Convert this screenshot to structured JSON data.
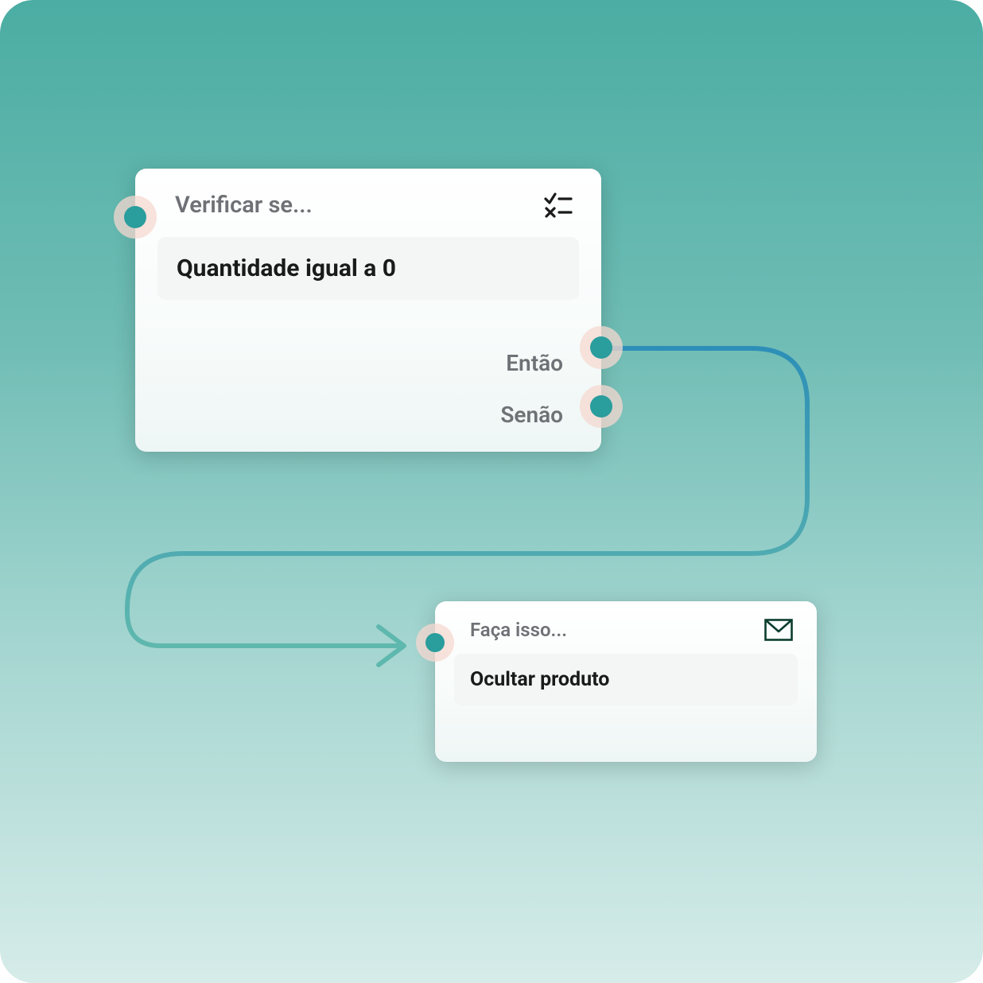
{
  "condition_card": {
    "title": "Verificar se...",
    "condition_text": "Quantidade igual a 0",
    "then_label": "Então",
    "else_label": "Senão"
  },
  "action_card": {
    "title": "Faça isso...",
    "action_text": "Ocultar produto"
  },
  "colors": {
    "port": "#2a9d9d",
    "connector_start": "#2d8fb7",
    "connector_end": "#5fb8ae"
  }
}
